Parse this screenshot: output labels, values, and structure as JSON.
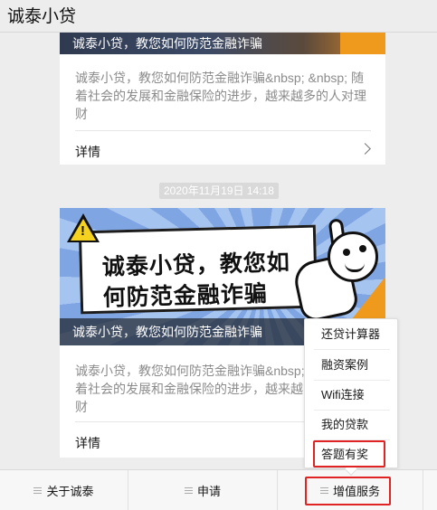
{
  "header": {
    "title": "诚泰小贷"
  },
  "articles": [
    {
      "image_caption": "诚泰小贷，教您如何防范金融诈骗",
      "description": "诚泰小贷，教您如何防范金融诈骗&nbsp; &nbsp; 随着社会的发展和金融保险的进步，越来越多的人对理财",
      "detail_label": "详情"
    },
    {
      "timestamp": "2020年11月19日 14:18",
      "banner_line1": "诚泰小贷，教您如",
      "banner_line2": "何防范金融诈骗",
      "image_caption": "诚泰小贷，教您如何防范金融诈骗",
      "description": "诚泰小贷，教您如何防范金融诈骗&nbsp; &nbsp; 随着社会的发展和金融保险的进步，越来越多的人对理财",
      "detail_label": "详情"
    }
  ],
  "popup_menu": {
    "items": [
      "还贷计算器",
      "融资案例",
      "Wifi连接",
      "我的贷款",
      "答题有奖"
    ]
  },
  "tabbar": {
    "tabs": [
      "关于诚泰",
      "申请",
      "增值服务"
    ]
  },
  "colors": {
    "background": "#ededed",
    "highlight": "#e02424",
    "banner_blue": "#8fb3ea",
    "banner_orange": "#f09a1d"
  }
}
